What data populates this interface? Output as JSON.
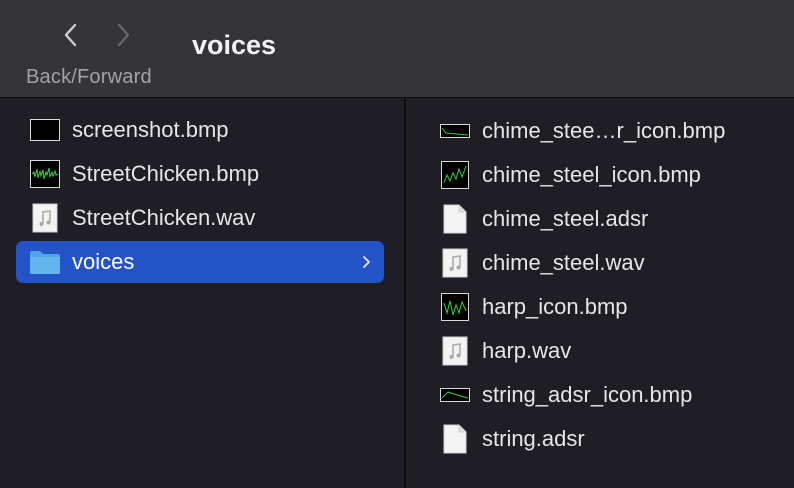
{
  "toolbar": {
    "back_forward_label": "Back/Forward",
    "title": "voices"
  },
  "left_column": {
    "items": [
      {
        "label": "screenshot.bmp",
        "icon": "bmp-black-thumbnail-icon"
      },
      {
        "label": "StreetChicken.bmp",
        "icon": "bmp-waveform-thumbnail-icon"
      },
      {
        "label": "StreetChicken.wav",
        "icon": "audio-file-icon"
      },
      {
        "label": "voices",
        "icon": "folder-icon",
        "selected": true
      }
    ]
  },
  "right_column": {
    "items": [
      {
        "label": "chime_stee…r_icon.bmp",
        "icon": "bmp-adsr-thumbnail-icon"
      },
      {
        "label": "chime_steel_icon.bmp",
        "icon": "bmp-waveform-thumbnail-icon"
      },
      {
        "label": "chime_steel.adsr",
        "icon": "document-icon"
      },
      {
        "label": "chime_steel.wav",
        "icon": "audio-file-icon"
      },
      {
        "label": "harp_icon.bmp",
        "icon": "bmp-waveform-thumbnail-icon"
      },
      {
        "label": "harp.wav",
        "icon": "audio-file-icon"
      },
      {
        "label": "string_adsr_icon.bmp",
        "icon": "bmp-adsr-thumbnail-icon"
      },
      {
        "label": "string.adsr",
        "icon": "document-icon"
      }
    ]
  },
  "colors": {
    "selection": "#2453c7",
    "toolbar": "#353439",
    "background": "#1f1e24",
    "folder": "#62b6ee",
    "waveform": "#3bd13b"
  }
}
